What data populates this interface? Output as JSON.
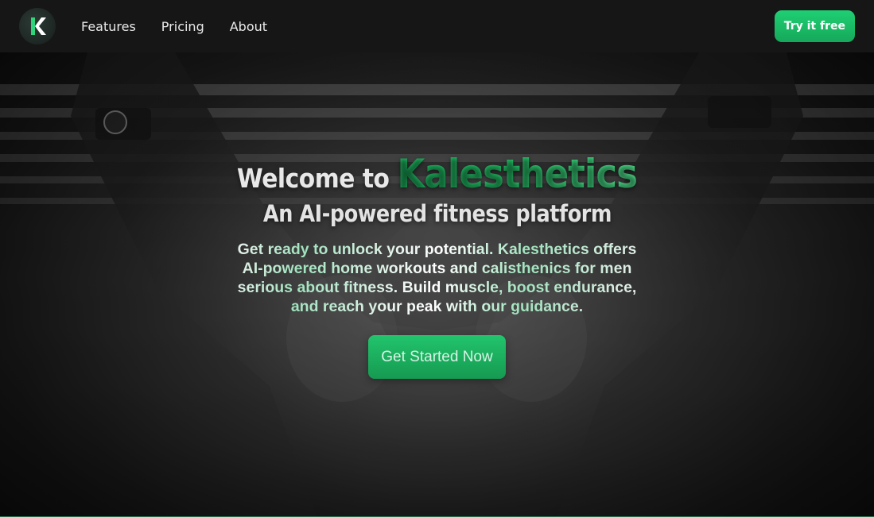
{
  "nav": {
    "logo_letter": "K",
    "links": [
      "Features",
      "Pricing",
      "About"
    ],
    "cta_label": "Try it free"
  },
  "hero": {
    "title_prefix": "Welcome to ",
    "brand": "Kalesthetics",
    "subtitle": "An AI-powered fitness platform",
    "description": "Get ready to unlock your potential. Kalesthetics offers AI-powered home workouts and calisthenics for men serious about fitness. Build muscle, boost endurance, and reach your peak with our guidance.",
    "cta_label": "Get Started Now"
  },
  "colors": {
    "accent": "#1fcf73",
    "nav_background": "#161616",
    "brand_gradient_end": "#4fe08d"
  }
}
